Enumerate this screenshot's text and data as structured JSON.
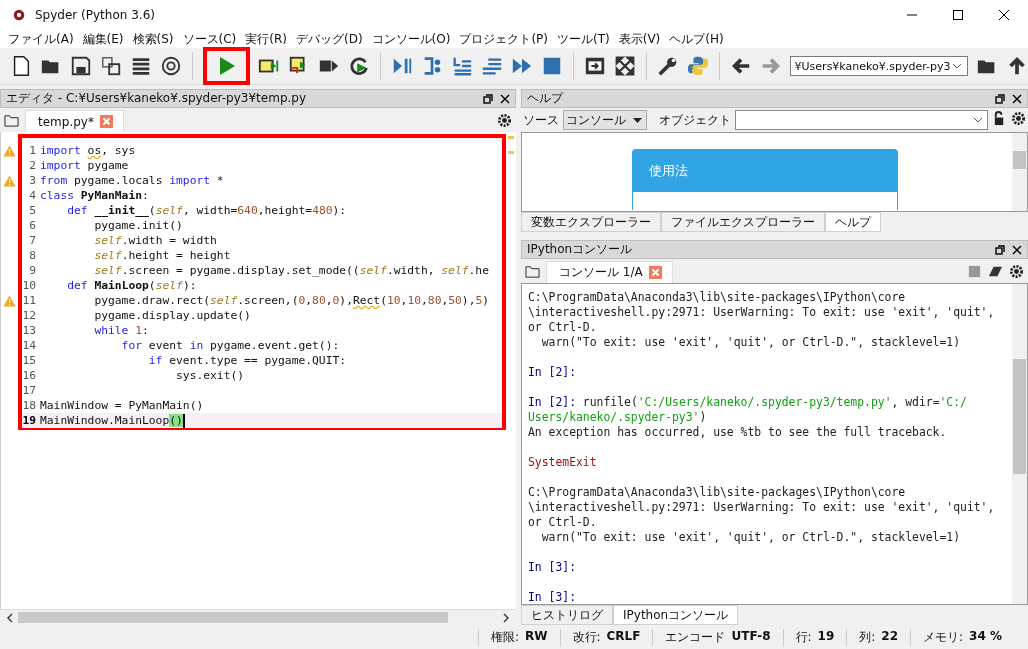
{
  "window": {
    "title": "Spyder (Python 3.6)"
  },
  "menu": [
    "ファイル(A)",
    "編集(E)",
    "検索(S)",
    "ソース(C)",
    "実行(R)",
    "デバッグ(D)",
    "コンソール(O)",
    "プロジェクト(P)",
    "ツール(T)",
    "表示(V)",
    "ヘルプ(H)"
  ],
  "toolbar": {
    "run_button": {
      "highlighted": true
    },
    "path": "¥Users¥kaneko¥.spyder-py3"
  },
  "editor": {
    "title": "エディタ - C:¥Users¥kaneko¥.spyder-py3¥temp.py",
    "tab": "temp.py*",
    "highlighted": true,
    "lines": [
      {
        "number": "1",
        "warning": true,
        "current": false,
        "tokens": [
          {
            "kind": "kw",
            "text": "import "
          },
          {
            "kind": "warn",
            "text": "os"
          },
          {
            "kind": "plain",
            "text": ", sys"
          }
        ]
      },
      {
        "number": "2",
        "warning": false,
        "current": false,
        "tokens": [
          {
            "kind": "kw",
            "text": "import"
          },
          {
            "kind": "plain",
            "text": " pygame"
          }
        ]
      },
      {
        "number": "3",
        "warning": true,
        "current": false,
        "tokens": [
          {
            "kind": "kw",
            "text": "from"
          },
          {
            "kind": "plain",
            "text": " pygame.locals "
          },
          {
            "kind": "kw",
            "text": "import"
          },
          {
            "kind": "plain",
            "text": " *"
          }
        ]
      },
      {
        "number": "4",
        "warning": false,
        "current": false,
        "tokens": [
          {
            "kind": "kw",
            "text": "class "
          },
          {
            "kind": "def",
            "text": "PyManMain"
          },
          {
            "kind": "plain",
            "text": ":"
          }
        ]
      },
      {
        "number": "5",
        "warning": false,
        "current": false,
        "tokens": [
          {
            "kind": "kw",
            "text": "    def "
          },
          {
            "kind": "def",
            "text": "__init__"
          },
          {
            "kind": "plain",
            "text": "("
          },
          {
            "kind": "self",
            "text": "self"
          },
          {
            "kind": "plain",
            "text": ", width="
          },
          {
            "kind": "num",
            "text": "640"
          },
          {
            "kind": "plain",
            "text": ",height="
          },
          {
            "kind": "num",
            "text": "480"
          },
          {
            "kind": "plain",
            "text": "):"
          }
        ]
      },
      {
        "number": "6",
        "warning": false,
        "current": false,
        "tokens": [
          {
            "kind": "plain",
            "text": "        pygame.init()"
          }
        ]
      },
      {
        "number": "7",
        "warning": false,
        "current": false,
        "tokens": [
          {
            "kind": "self",
            "text": "        self"
          },
          {
            "kind": "plain",
            "text": ".width = width"
          }
        ]
      },
      {
        "number": "8",
        "warning": false,
        "current": false,
        "tokens": [
          {
            "kind": "self",
            "text": "        self"
          },
          {
            "kind": "plain",
            "text": ".height = height"
          }
        ]
      },
      {
        "number": "9",
        "warning": false,
        "current": false,
        "tokens": [
          {
            "kind": "self",
            "text": "        self"
          },
          {
            "kind": "plain",
            "text": ".screen = pygame.display.set_mode(("
          },
          {
            "kind": "self",
            "text": "self"
          },
          {
            "kind": "plain",
            "text": ".width, "
          },
          {
            "kind": "self",
            "text": "self"
          },
          {
            "kind": "plain",
            "text": ".he"
          }
        ]
      },
      {
        "number": "10",
        "warning": false,
        "current": false,
        "tokens": [
          {
            "kind": "kw",
            "text": "    def "
          },
          {
            "kind": "def",
            "text": "MainLoop"
          },
          {
            "kind": "plain",
            "text": "("
          },
          {
            "kind": "self",
            "text": "self"
          },
          {
            "kind": "plain",
            "text": "):"
          }
        ]
      },
      {
        "number": "11",
        "warning": true,
        "current": false,
        "tokens": [
          {
            "kind": "plain",
            "text": "        pygame.draw.rect("
          },
          {
            "kind": "self",
            "text": "self"
          },
          {
            "kind": "plain",
            "text": ".screen,("
          },
          {
            "kind": "num",
            "text": "0"
          },
          {
            "kind": "plain",
            "text": ","
          },
          {
            "kind": "num",
            "text": "80"
          },
          {
            "kind": "plain",
            "text": ","
          },
          {
            "kind": "num",
            "text": "0"
          },
          {
            "kind": "plain",
            "text": "),"
          },
          {
            "kind": "warn",
            "text": "Rect"
          },
          {
            "kind": "plain",
            "text": "("
          },
          {
            "kind": "num",
            "text": "10"
          },
          {
            "kind": "plain",
            "text": ","
          },
          {
            "kind": "num",
            "text": "10"
          },
          {
            "kind": "plain",
            "text": ","
          },
          {
            "kind": "num",
            "text": "80"
          },
          {
            "kind": "plain",
            "text": ","
          },
          {
            "kind": "num",
            "text": "50"
          },
          {
            "kind": "plain",
            "text": "),"
          },
          {
            "kind": "num",
            "text": "5"
          },
          {
            "kind": "plain",
            "text": ")"
          }
        ]
      },
      {
        "number": "12",
        "warning": false,
        "current": false,
        "tokens": [
          {
            "kind": "plain",
            "text": "        pygame.display.update()"
          }
        ]
      },
      {
        "number": "13",
        "warning": false,
        "current": false,
        "tokens": [
          {
            "kind": "kw",
            "text": "        while "
          },
          {
            "kind": "num",
            "text": "1"
          },
          {
            "kind": "plain",
            "text": ":"
          }
        ]
      },
      {
        "number": "14",
        "warning": false,
        "current": false,
        "tokens": [
          {
            "kind": "kw",
            "text": "            for"
          },
          {
            "kind": "plain",
            "text": " event "
          },
          {
            "kind": "kw",
            "text": "in"
          },
          {
            "kind": "plain",
            "text": " pygame.event.get():"
          }
        ]
      },
      {
        "number": "15",
        "warning": false,
        "current": false,
        "tokens": [
          {
            "kind": "kw",
            "text": "                if"
          },
          {
            "kind": "plain",
            "text": " event.type == pygame.QUIT:"
          }
        ]
      },
      {
        "number": "16",
        "warning": false,
        "current": false,
        "tokens": [
          {
            "kind": "plain",
            "text": "                    sys.exit()"
          }
        ]
      },
      {
        "number": "17",
        "warning": false,
        "current": false
      },
      {
        "number": "18",
        "warning": false,
        "current": false,
        "tokens": [
          {
            "kind": "plain",
            "text": "MainWindow = PyManMain()"
          }
        ]
      },
      {
        "number": "19",
        "warning": false,
        "current": true,
        "tokens": [
          {
            "kind": "plain",
            "text": "MainWindow.MainLoop"
          },
          {
            "kind": "match",
            "text": "()"
          }
        ]
      }
    ]
  },
  "help": {
    "title": "ヘルプ",
    "source_label": "ソース",
    "source": "コンソール",
    "object_label": "オブジェクト",
    "card_title": "使用法",
    "tabs": [
      {
        "label": "変数エクスプローラー",
        "selected": false
      },
      {
        "label": "ファイルエクスプローラー",
        "selected": false
      },
      {
        "label": "ヘルプ",
        "selected": true
      }
    ]
  },
  "console": {
    "title": "IPythonコンソール",
    "tab": "コンソール 1/A",
    "lines": [
      {
        "blank_before": false,
        "segments": [
          {
            "kind": "plain",
            "text": "C:\\ProgramData\\Anaconda3\\lib\\site-packages\\IPython\\core"
          }
        ]
      },
      {
        "blank_before": false,
        "segments": [
          {
            "kind": "plain",
            "text": "\\interactiveshell.py:2971: UserWarning: To exit: use 'exit', 'quit',"
          }
        ]
      },
      {
        "blank_before": false,
        "segments": [
          {
            "kind": "plain",
            "text": "or Ctrl-D."
          }
        ]
      },
      {
        "blank_before": false,
        "segments": [
          {
            "kind": "plain",
            "text": "  warn(\"To exit: use 'exit', 'quit', or Ctrl-D.\", stacklevel=1)"
          }
        ]
      },
      {
        "blank_before": true,
        "segments": [
          {
            "kind": "prompt",
            "text": "In [2]:"
          }
        ]
      },
      {
        "blank_before": true,
        "segments": [
          {
            "kind": "prompt",
            "text": "In [2]:"
          },
          {
            "kind": "plain",
            "text": " runfile("
          },
          {
            "kind": "string",
            "text": "'C:/Users/kaneko/.spyder-py3/temp.py'"
          },
          {
            "kind": "plain",
            "text": ", wdir="
          },
          {
            "kind": "string",
            "text": "'C:/"
          }
        ]
      },
      {
        "blank_before": false,
        "segments": [
          {
            "kind": "string",
            "text": "Users/kaneko/.spyder-py3'"
          },
          {
            "kind": "plain",
            "text": ")"
          }
        ]
      },
      {
        "blank_before": false,
        "segments": [
          {
            "kind": "plain",
            "text": "An exception has occurred, use %tb to see the full traceback."
          }
        ]
      },
      {
        "blank_before": true,
        "segments": [
          {
            "kind": "error",
            "text": "SystemExit"
          }
        ]
      },
      {
        "blank_before": true,
        "segments": [
          {
            "kind": "plain",
            "text": "C:\\ProgramData\\Anaconda3\\lib\\site-packages\\IPython\\core"
          }
        ]
      },
      {
        "blank_before": false,
        "segments": [
          {
            "kind": "plain",
            "text": "\\interactiveshell.py:2971: UserWarning: To exit: use 'exit', 'quit',"
          }
        ]
      },
      {
        "blank_before": false,
        "segments": [
          {
            "kind": "plain",
            "text": "or Ctrl-D."
          }
        ]
      },
      {
        "blank_before": false,
        "segments": [
          {
            "kind": "plain",
            "text": "  warn(\"To exit: use 'exit', 'quit', or Ctrl-D.\", stacklevel=1)"
          }
        ]
      },
      {
        "blank_before": true,
        "segments": [
          {
            "kind": "prompt",
            "text": "In [3]:"
          }
        ]
      },
      {
        "blank_before": true,
        "segments": [
          {
            "kind": "prompt",
            "text": "In [3]:"
          }
        ]
      }
    ],
    "tabs": [
      {
        "label": "ヒストリログ",
        "selected": false
      },
      {
        "label": "IPythonコンソール",
        "selected": true
      }
    ]
  },
  "status_bar": [
    {
      "label": "権限:",
      "value": "RW"
    },
    {
      "label": "改行:",
      "value": "CRLF"
    },
    {
      "label": "エンコード",
      "value": "UTF-8"
    },
    {
      "label": "行:",
      "value": "19"
    },
    {
      "label": "列:",
      "value": "22"
    },
    {
      "label": "メモリ:",
      "value": "34 %"
    }
  ]
}
